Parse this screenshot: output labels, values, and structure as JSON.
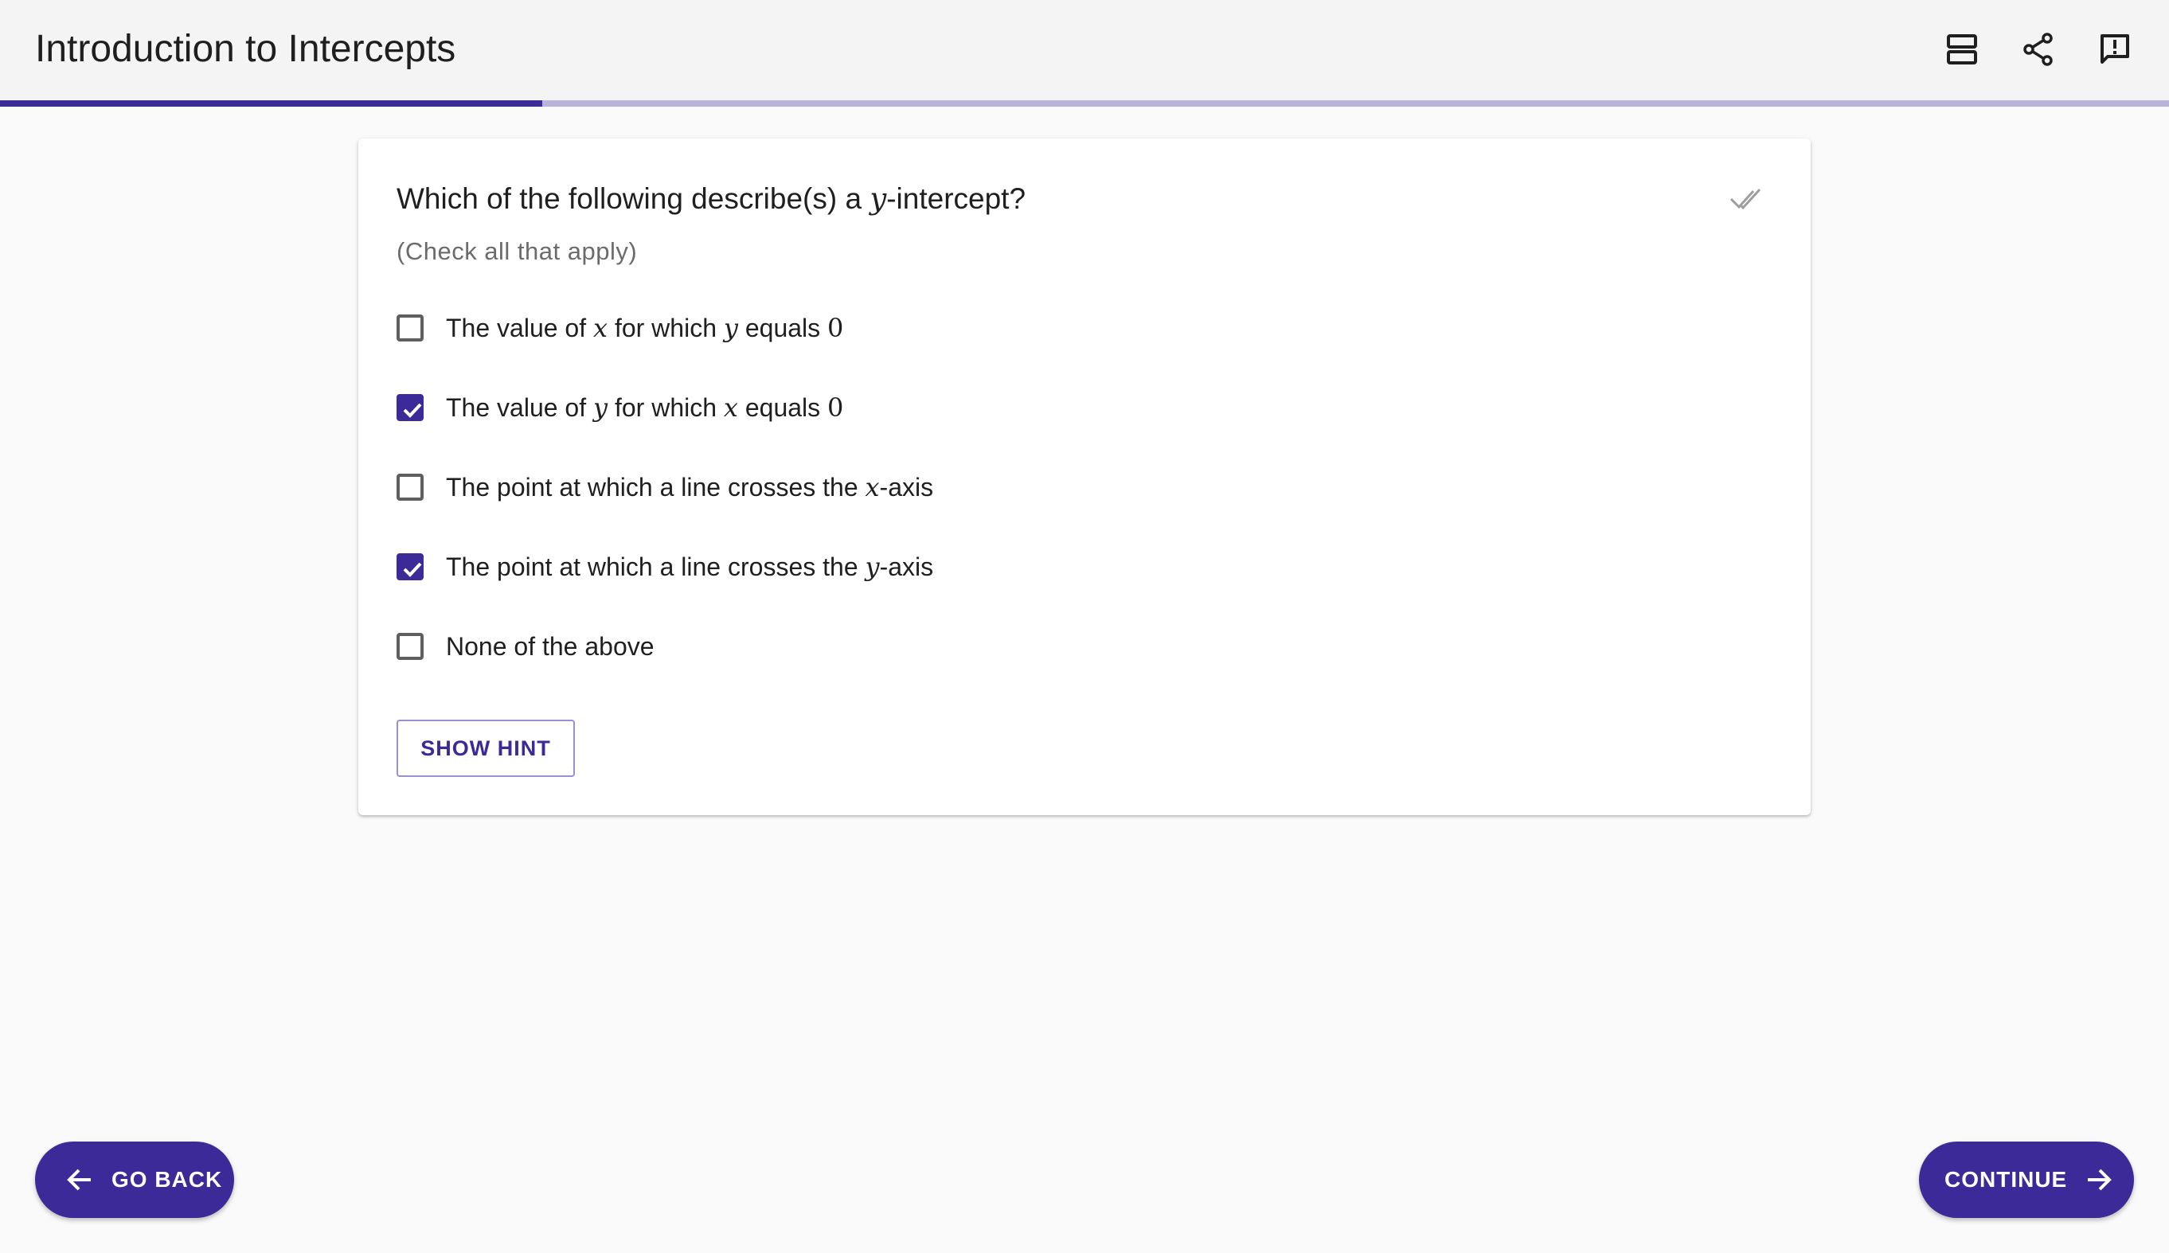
{
  "app": {
    "title": "Introduction to Intercepts",
    "progress_fraction": 0.25,
    "accent_color": "#3b2a98",
    "progress_track_color": "#b9b3d9",
    "icons": [
      "view-agenda-icon",
      "share-icon",
      "feedback-icon"
    ]
  },
  "question": {
    "prefix": "Which of the following describe(s) a ",
    "math": "y",
    "suffix": "-intercept?",
    "instruction": "(Check all that apply)",
    "status_icon": "double-check-icon"
  },
  "options": [
    {
      "parts": [
        "The value of ",
        "x",
        " for which ",
        "y",
        " equals ",
        "0"
      ],
      "checked": false
    },
    {
      "parts": [
        "The value of ",
        "y",
        " for which ",
        "x",
        " equals ",
        "0"
      ],
      "checked": true
    },
    {
      "parts": [
        "The point at which a line crosses the ",
        "x",
        "-axis"
      ],
      "checked": false
    },
    {
      "parts": [
        "The point at which a line crosses the ",
        "y",
        "-axis"
      ],
      "checked": true
    },
    {
      "parts": [
        "None of the above"
      ],
      "checked": false
    }
  ],
  "hint_button": {
    "label": "SHOW HINT"
  },
  "navigation": {
    "back_label": "GO BACK",
    "continue_label": "CONTINUE"
  }
}
